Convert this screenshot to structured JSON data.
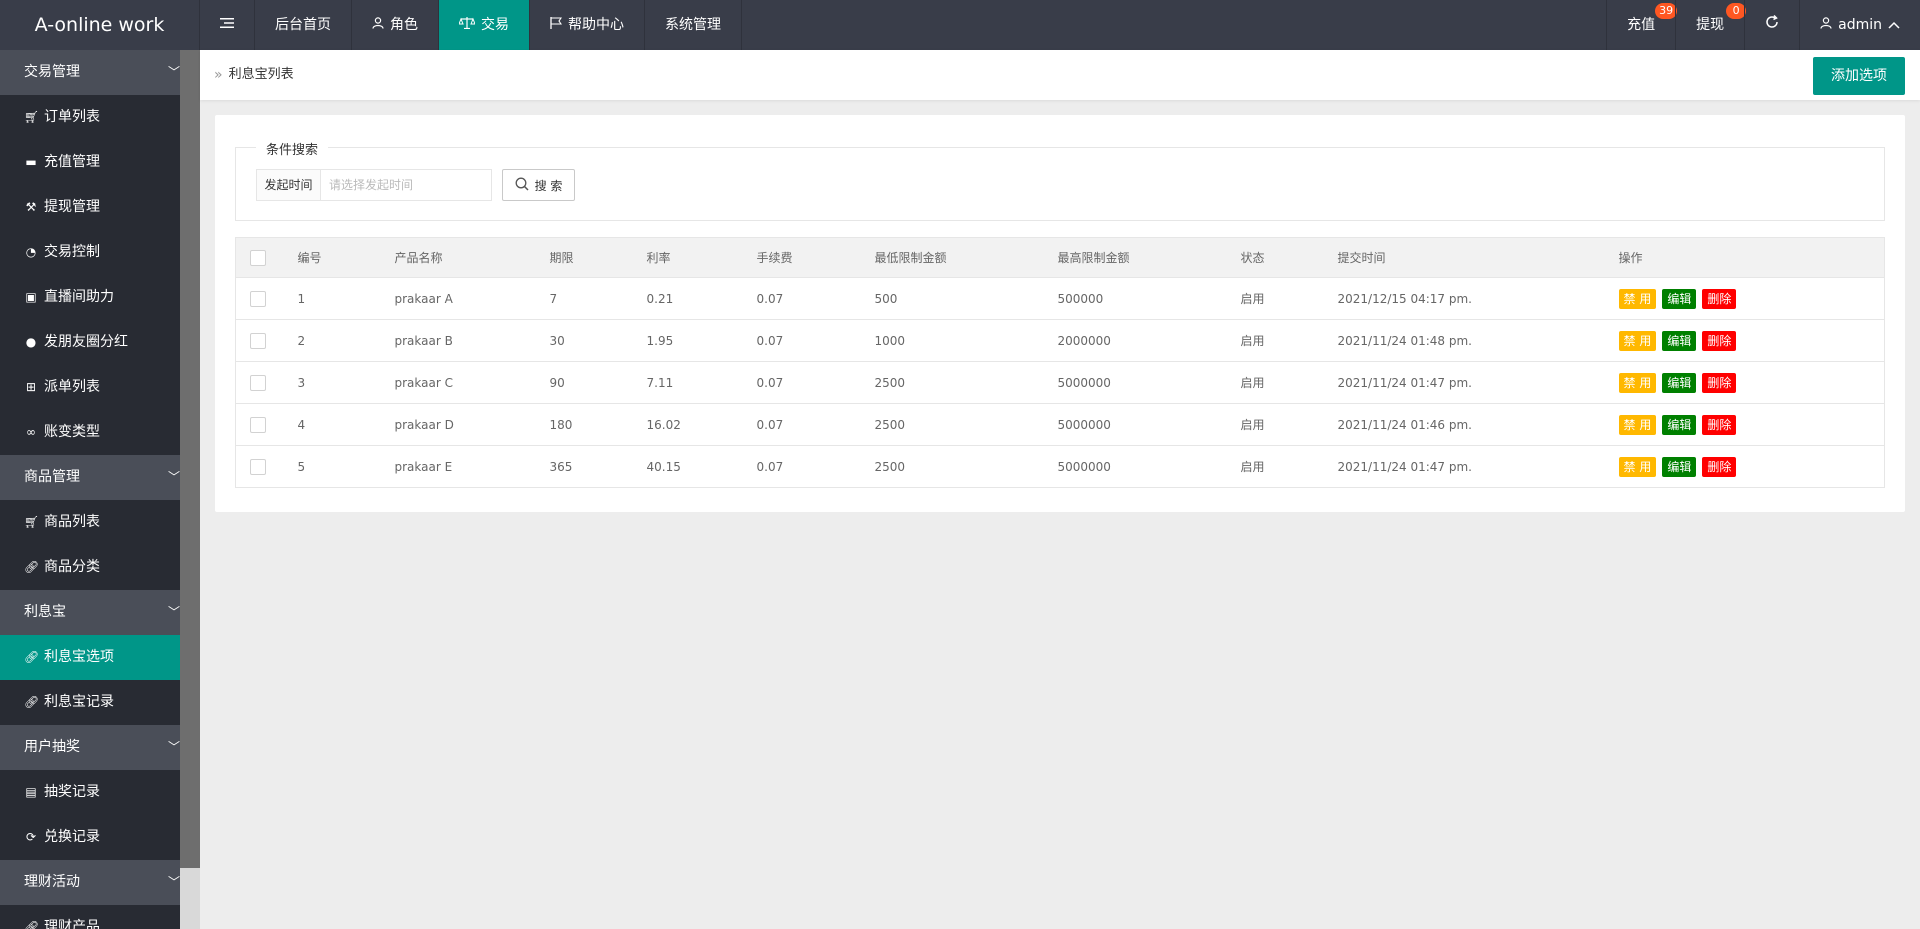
{
  "app": {
    "title": "A-online work"
  },
  "nav": {
    "toggle_icon": "menu-icon",
    "items": [
      {
        "label": "后台首页",
        "icon": ""
      },
      {
        "label": "角色",
        "icon": "user-icon"
      },
      {
        "label": "交易",
        "icon": "scale-icon",
        "active": true
      },
      {
        "label": "帮助中心",
        "icon": "flag-icon"
      },
      {
        "label": "系统管理",
        "icon": ""
      }
    ],
    "right": {
      "recharge_label": "充值",
      "recharge_badge": "39",
      "withdraw_label": "提现",
      "withdraw_badge": "0",
      "refresh_icon": "refresh-icon",
      "user_label": "admin"
    }
  },
  "sidebar": {
    "groups": [
      {
        "label": "交易管理",
        "items": [
          {
            "label": "订单列表",
            "icon": "cart-icon"
          },
          {
            "label": "充值管理",
            "icon": "card-icon"
          },
          {
            "label": "提现管理",
            "icon": "gavel-icon"
          },
          {
            "label": "交易控制",
            "icon": "dashboard-icon"
          },
          {
            "label": "直播间助力",
            "icon": "play-icon"
          },
          {
            "label": "发朋友圈分红",
            "icon": "globe-icon"
          },
          {
            "label": "派单列表",
            "icon": "book-icon"
          },
          {
            "label": "账变类型",
            "icon": "infinity-icon"
          }
        ]
      },
      {
        "label": "商品管理",
        "items": [
          {
            "label": "商品列表",
            "icon": "cart-icon"
          },
          {
            "label": "商品分类",
            "icon": "link-icon"
          }
        ]
      },
      {
        "label": "利息宝",
        "items": [
          {
            "label": "利息宝选项",
            "icon": "link-icon",
            "active": true
          },
          {
            "label": "利息宝记录",
            "icon": "link-icon"
          }
        ]
      },
      {
        "label": "用户抽奖",
        "items": [
          {
            "label": "抽奖记录",
            "icon": "clipboard-icon"
          },
          {
            "label": "兑换记录",
            "icon": "refresh-icon"
          }
        ]
      },
      {
        "label": "理财活动",
        "items": [
          {
            "label": "理财产品",
            "icon": "link-icon"
          }
        ]
      }
    ]
  },
  "breadcrumb": {
    "current": "利息宝列表"
  },
  "actions": {
    "add_label": "添加选项"
  },
  "search": {
    "legend": "条件搜索",
    "time_label": "发起时间",
    "time_placeholder": "请选择发起时间",
    "button_label": "搜 索"
  },
  "table": {
    "headers": [
      "编号",
      "产品名称",
      "期限",
      "利率",
      "手续费",
      "最低限制金额",
      "最高限制金额",
      "状态",
      "提交时间",
      "操作"
    ],
    "rows": [
      {
        "id": "1",
        "name": "prakaar A",
        "term": "7",
        "rate": "0.21",
        "fee": "0.07",
        "min": "500",
        "max": "500000",
        "status": "启用",
        "time": "2021/12/15 04:17 pm."
      },
      {
        "id": "2",
        "name": "prakaar B",
        "term": "30",
        "rate": "1.95",
        "fee": "0.07",
        "min": "1000",
        "max": "2000000",
        "status": "启用",
        "time": "2021/11/24 01:48 pm."
      },
      {
        "id": "3",
        "name": "prakaar C",
        "term": "90",
        "rate": "7.11",
        "fee": "0.07",
        "min": "2500",
        "max": "5000000",
        "status": "启用",
        "time": "2021/11/24 01:47 pm."
      },
      {
        "id": "4",
        "name": "prakaar D",
        "term": "180",
        "rate": "16.02",
        "fee": "0.07",
        "min": "2500",
        "max": "5000000",
        "status": "启用",
        "time": "2021/11/24 01:46 pm."
      },
      {
        "id": "5",
        "name": "prakaar E",
        "term": "365",
        "rate": "40.15",
        "fee": "0.07",
        "min": "2500",
        "max": "5000000",
        "status": "启用",
        "time": "2021/11/24 01:47 pm."
      }
    ],
    "ops": {
      "disable": "禁 用",
      "edit": "编辑",
      "delete": "删除"
    }
  },
  "colors": {
    "header_bg": "#393d49",
    "accent": "#009688",
    "disable": "#ffb800",
    "edit": "#008000",
    "delete": "#ff0000"
  }
}
